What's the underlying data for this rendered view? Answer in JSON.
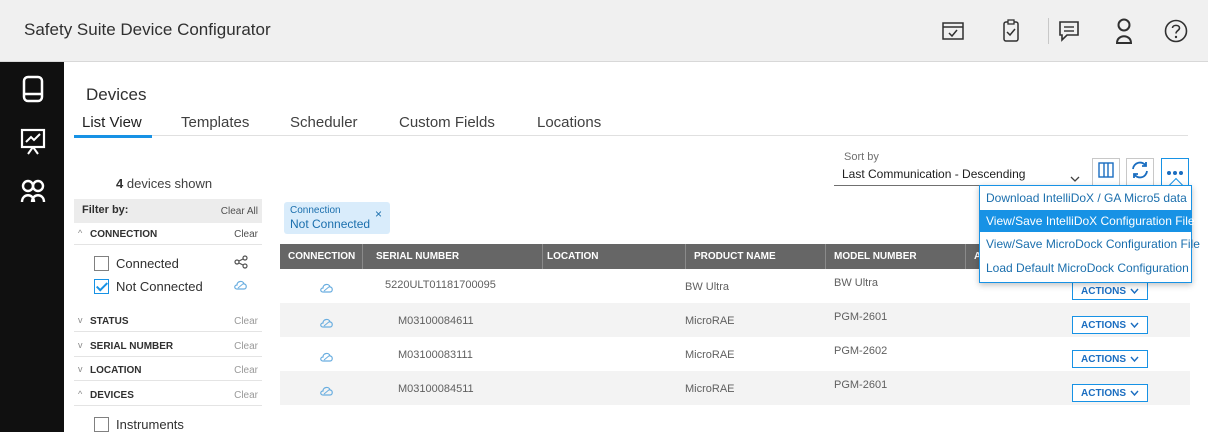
{
  "app": {
    "title": "Safety Suite Device Configurator"
  },
  "topbar_icons": [
    "calendar-check-icon",
    "clipboard-check-icon",
    "chat-icon",
    "user-icon",
    "help-icon"
  ],
  "leftnav_icons": [
    "device-icon",
    "presentation-chart-icon",
    "group-icon"
  ],
  "page": {
    "title": "Devices"
  },
  "tabs": [
    "List View",
    "Templates",
    "Scheduler",
    "Custom Fields",
    "Locations"
  ],
  "devices_count": "4",
  "devices_shown_label": "devices shown",
  "filters": {
    "filter_by": "Filter by:",
    "clear_all": "Clear All",
    "clear": "Clear",
    "sections": [
      "CONNECTION",
      "STATUS",
      "SERIAL NUMBER",
      "LOCATION",
      "DEVICES"
    ],
    "connection_options": [
      {
        "label": "Connected",
        "checked": false
      },
      {
        "label": "Not Connected",
        "checked": true
      }
    ],
    "device_options": [
      {
        "label": "Instruments",
        "checked": false
      }
    ]
  },
  "sort": {
    "label": "Sort by",
    "value": "Last Communication - Descending"
  },
  "chip": {
    "title": "Connection",
    "value": "Not Connected",
    "close": "×"
  },
  "table": {
    "columns": [
      "CONNECTION",
      "SERIAL NUMBER",
      "LOCATION",
      "PRODUCT NAME",
      "MODEL NUMBER",
      "A"
    ],
    "rows": [
      {
        "serial": "5220ULT01181700095",
        "product": "BW Ultra",
        "model": "BW Ultra",
        "action": "ACTIONS"
      },
      {
        "serial": "M03100084611",
        "product": "MicroRAE",
        "model": "PGM-2601",
        "action": "ACTIONS"
      },
      {
        "serial": "M03100083111",
        "product": "MicroRAE",
        "model": "PGM-2602",
        "action": "ACTIONS"
      },
      {
        "serial": "M03100084511",
        "product": "MicroRAE",
        "model": "PGM-2601",
        "action": "ACTIONS"
      }
    ]
  },
  "menu": {
    "items": [
      "Download IntelliDoX / GA Micro5 data",
      "View/Save IntelliDoX Configuration File",
      "View/Save MicroDock Configuration File",
      "Load Default MicroDock Configuration"
    ],
    "selected_index": 1
  },
  "colors": {
    "accent": "#1792e5",
    "nav_bg": "#101010",
    "header_bg": "#666666"
  }
}
